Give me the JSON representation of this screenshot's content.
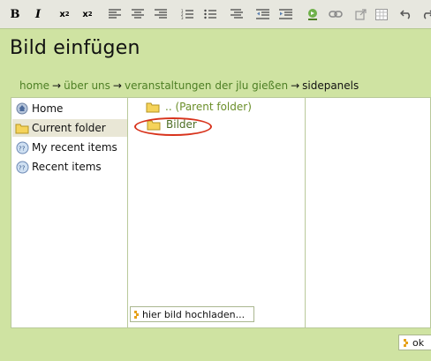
{
  "toolbar": {
    "bold": "B",
    "italic": "I",
    "subscript_base": "x",
    "subscript_mark": "2",
    "superscript_base": "x",
    "superscript_mark": "2",
    "icons": [
      "align-left-icon",
      "align-center-icon",
      "align-right-icon",
      "numbered-list-icon",
      "bullet-list-icon",
      "definition-list-icon",
      "outdent-icon",
      "indent-icon",
      "insert-image-icon",
      "link-icon",
      "external-link-icon",
      "table-icon",
      "undo-icon",
      "redo-icon"
    ]
  },
  "dialog": {
    "title": "Bild einfügen"
  },
  "breadcrumb": {
    "items": [
      "home",
      "über uns",
      "veranstaltungen der jlu gießen"
    ],
    "separator": "→",
    "current": "sidepanels"
  },
  "nav": {
    "items": [
      {
        "label": "Home",
        "icon": "home-icon"
      },
      {
        "label": "Current folder",
        "icon": "folder-icon"
      },
      {
        "label": "My recent items",
        "icon": "recent-icon"
      },
      {
        "label": "Recent items",
        "icon": "recent-icon"
      }
    ]
  },
  "browser": {
    "parent_folder": ".. (Parent folder)",
    "folder": "Bilder",
    "upload_label": "hier bild hochladen..."
  },
  "footer": {
    "ok_label": "ok"
  },
  "colors": {
    "background": "#cfe3a2",
    "link": "#4d7f24",
    "highlight": "#d8331c",
    "folder": "#f5d35a"
  }
}
